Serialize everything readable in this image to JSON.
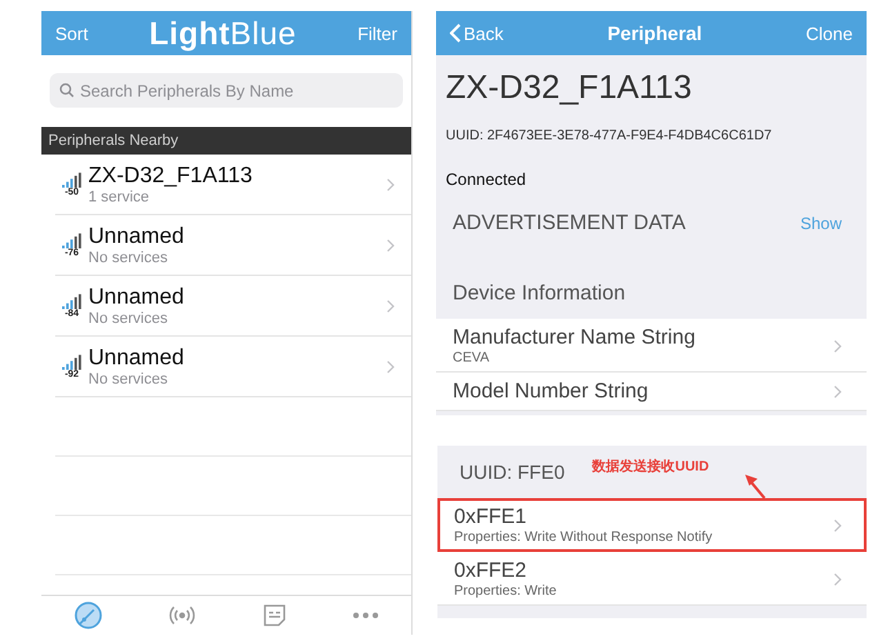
{
  "left_screen": {
    "nav": {
      "left": "Sort",
      "title_bold": "Light",
      "title_light": "Blue",
      "right": "Filter"
    },
    "search": {
      "placeholder": "Search Peripherals By Name"
    },
    "section_header": "Peripherals Nearby",
    "peripherals": [
      {
        "name": "ZX-D32_F1A113",
        "rssi": "-50",
        "detail": "1 service"
      },
      {
        "name": "Unnamed",
        "rssi": "-76",
        "detail": "No services"
      },
      {
        "name": "Unnamed",
        "rssi": "-84",
        "detail": "No services"
      },
      {
        "name": "Unnamed",
        "rssi": "-92",
        "detail": "No services"
      }
    ],
    "tabs": [
      {
        "kind": "radar",
        "selected": true
      },
      {
        "kind": "broadcast",
        "selected": false
      },
      {
        "kind": "log",
        "selected": false
      },
      {
        "kind": "more",
        "selected": false
      }
    ]
  },
  "right_screen": {
    "nav": {
      "back": "Back",
      "title": "Peripheral",
      "right": "Clone"
    },
    "device_name": "ZX-D32_F1A113",
    "uuid": "UUID: 2F4673EE-3E78-477A-F9E4-F4DB4C6C61D7",
    "status": "Connected",
    "advertisement": {
      "label": "ADVERTISEMENT DATA",
      "action": "Show"
    },
    "service_title": "Device Information",
    "characteristics": [
      {
        "name": "Manufacturer Name String",
        "value": "CEVA"
      },
      {
        "name": "Model Number String"
      }
    ]
  },
  "service_panel": {
    "title": "UUID: FFE0",
    "annotation": "数据发送接收UUID",
    "characteristics": [
      {
        "name": "0xFFE1",
        "properties": "Properties: Write Without Response Notify",
        "highlighted": true
      },
      {
        "name": "0xFFE2",
        "properties": "Properties: Write",
        "highlighted": false
      }
    ]
  }
}
